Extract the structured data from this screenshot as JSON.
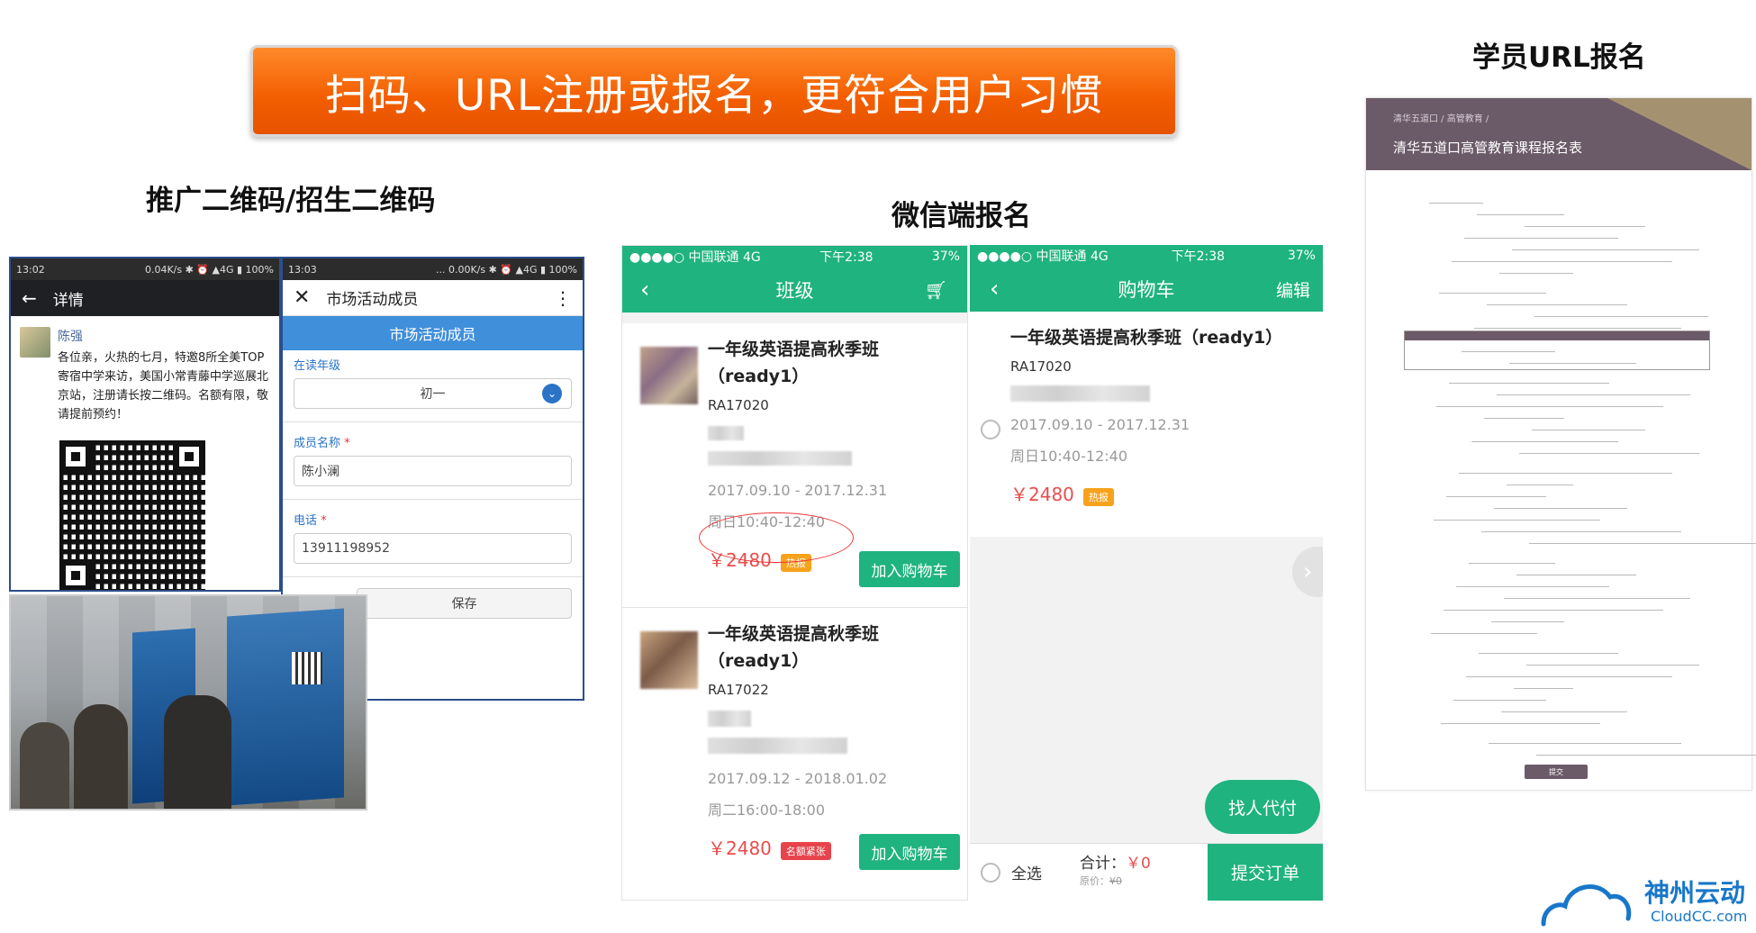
{
  "banner": {
    "title": "扫码、URL注册或报名，更符合用户习惯"
  },
  "headings": {
    "qr": "推广二维码/招生二维码",
    "wechat": "微信端报名",
    "url": "学员URL报名"
  },
  "phone1": {
    "status_time": "13:02",
    "status_right": "0.04K/s ✱ ⏰ ▲4G ▮ 100%",
    "nav_title": "详情",
    "author": "陈强",
    "post": "各位亲，火热的七月，特邀8所全美TOP寄宿中学来访，美国小常青藤中学巡展北京站，注册请长按二维码。名额有限，敬请提前预约！"
  },
  "phone2": {
    "status_time": "13:03",
    "status_right": "... 0.00K/s ✱ ⏰ ▲4G ▮ 100%",
    "nav_title": "市场活动成员",
    "section_header": "市场活动成员",
    "grade_label": "在读年级",
    "grade_value": "初一",
    "name_label": "成员名称",
    "name_value": "陈小澜",
    "phone_label": "电话",
    "phone_value": "13911198952",
    "save_label": "保存",
    "required_mark": "*"
  },
  "wechat_class": {
    "carrier": "●●●●○ 中国联通  4G",
    "time": "下午2:38",
    "battery": "37%",
    "nav_title": "班级",
    "courses": [
      {
        "title": "一年级英语提高秋季班（ready1）",
        "code": "RA17020",
        "dates": "2017.09.10 - 2017.12.31",
        "schedule": "周日10:40-12:40",
        "price": "￥2480",
        "tag": "热报",
        "button": "加入购物车"
      },
      {
        "title": "一年级英语提高秋季班（ready1）",
        "code": "RA17022",
        "dates": "2017.09.12 - 2018.01.02",
        "schedule": "周二16:00-18:00",
        "price": "￥2480",
        "tag": "名额紧张",
        "button": "加入购物车"
      }
    ]
  },
  "wechat_cart": {
    "carrier": "●●●●○ 中国联通  4G",
    "time": "下午2:38",
    "battery": "37%",
    "nav_title": "购物车",
    "nav_edit": "编辑",
    "item": {
      "title": "一年级英语提高秋季班（ready1）",
      "code": "RA17020",
      "dates": "2017.09.10 - 2017.12.31",
      "schedule": "周日10:40-12:40",
      "price": "￥2480",
      "tag": "热报"
    },
    "proxy_button": "找人代付",
    "select_all": "全选",
    "total_label": "合计：",
    "total_value": "￥0",
    "original_label": "原价：",
    "original_value": "¥0",
    "submit_button": "提交订单"
  },
  "reg_form": {
    "breadcrumb": "清华五道口 / 高管教育 /",
    "title": "清华五道口高管教育课程报名表",
    "submit_label": "提交"
  },
  "logo": {
    "name": "神州云动",
    "sub": "CloudCC.com"
  },
  "colors": {
    "banner": "#f25d00",
    "wechat_green": "#1fb37f",
    "form_header": "#6b5a67",
    "logo_blue": "#1877c9"
  }
}
